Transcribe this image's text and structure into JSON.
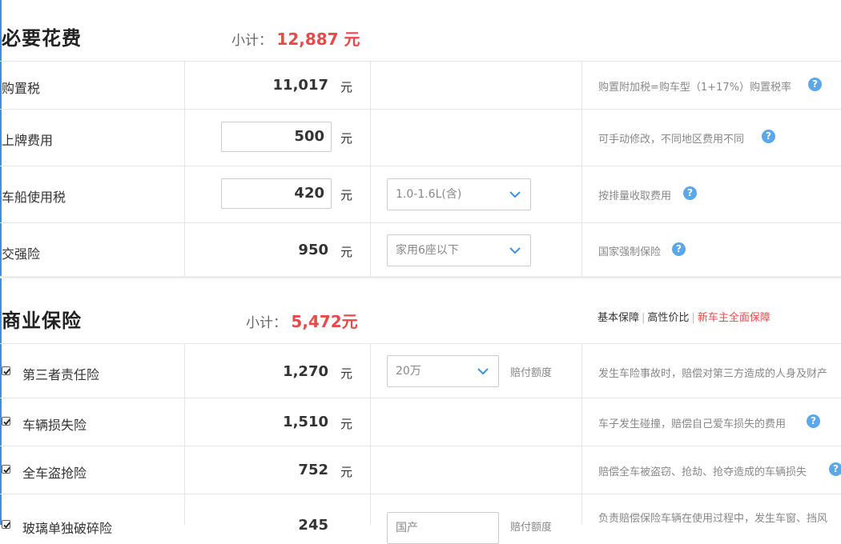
{
  "sections": {
    "required": {
      "title": "必要花费",
      "subtotal_label": "小计：",
      "subtotal_value": "12,887 元"
    },
    "commercial": {
      "title": "商业保险",
      "subtotal_label": "小计：",
      "subtotal_value": "5,472元",
      "tabs": [
        "基本保障",
        "高性价比",
        "新车主全面保障"
      ]
    }
  },
  "required_rows": [
    {
      "label": "购置税",
      "value": "11,017",
      "unit": "元",
      "hint": "购置附加税=购车型（1+17%）购置税率"
    },
    {
      "label": "上牌费用",
      "value": "500",
      "unit": "元",
      "hint": "可手动修改，不同地区费用不同"
    },
    {
      "label": "车船使用税",
      "value": "420",
      "unit": "元",
      "select": "1.0-1.6L(含)",
      "hint": "按排量收取费用"
    },
    {
      "label": "交强险",
      "value": "950",
      "unit": "元",
      "select": "家用6座以下",
      "hint": "国家强制保险"
    }
  ],
  "commercial_rows": [
    {
      "label": "第三者责任险",
      "value": "1,270",
      "unit": "元",
      "checked": true,
      "select": "20万",
      "extra": "赔付额度",
      "hint": "发生车险事故时，赔偿对第三方造成的人身及财产"
    },
    {
      "label": "车辆损失险",
      "value": "1,510",
      "unit": "元",
      "checked": true,
      "hint": "车子发生碰撞，赔偿自己爱车损失的费用"
    },
    {
      "label": "全车盗抢险",
      "value": "752",
      "unit": "元",
      "checked": true,
      "hint": "赔偿全车被盗窃、抢劫、抢夺造成的车辆损失"
    },
    {
      "label": "玻璃单独破碎险",
      "value": "245",
      "unit": "元",
      "checked": true,
      "select": "国产",
      "extra": "赔付额度",
      "hint": "负责赔偿保险车辆在使用过程中，发生车窗、挡风"
    }
  ],
  "icons": {
    "help": "?",
    "help_color": "#5aa7ea",
    "accent": "#e84a4a"
  }
}
